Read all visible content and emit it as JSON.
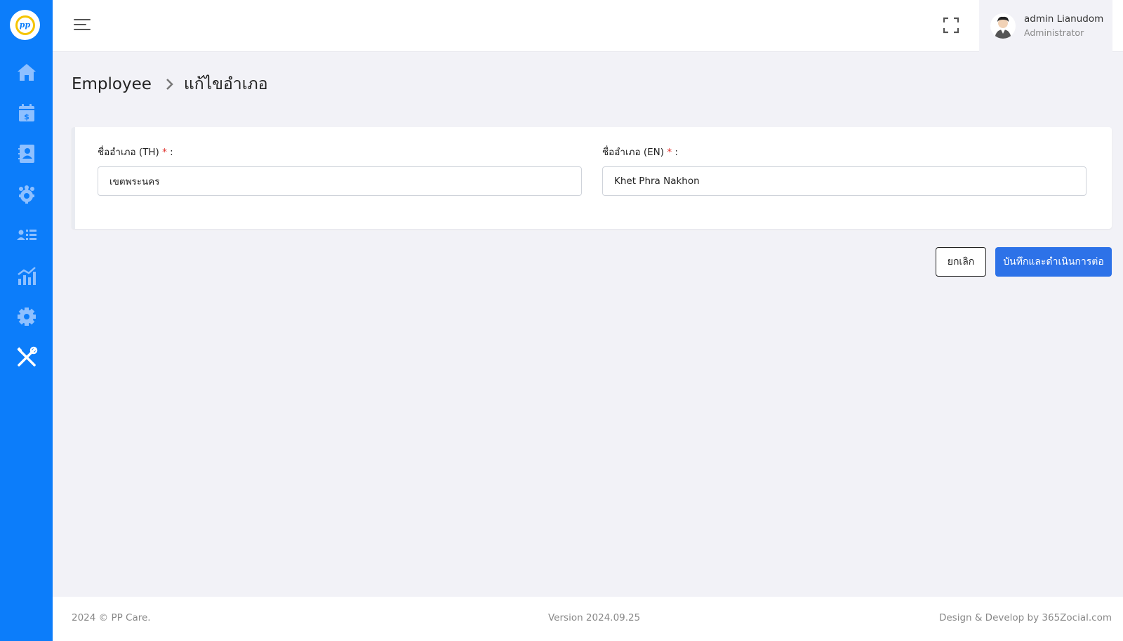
{
  "sidebar": {
    "logo_text": "pp",
    "items": [
      {
        "icon": "home-icon"
      },
      {
        "icon": "calendar-dollar-icon"
      },
      {
        "icon": "contact-book-icon"
      },
      {
        "icon": "people-gear-icon"
      },
      {
        "icon": "user-list-icon"
      },
      {
        "icon": "chart-icon"
      },
      {
        "icon": "gear-icon"
      },
      {
        "icon": "tools-icon"
      }
    ],
    "color": "#0c7dfa"
  },
  "header": {
    "user_name": "admin Lianudom",
    "user_role": "Administrator"
  },
  "breadcrumb": {
    "parent": "Employee",
    "current": "แก้ไขอำเภอ"
  },
  "form": {
    "th_label": "ชื่ออำเภอ (TH)",
    "th_value": "เขตพระนคร",
    "en_label": "ชื่ออำเภอ (EN)",
    "en_value": "Khet Phra Nakhon",
    "required_mark": "*",
    "label_suffix": ":"
  },
  "buttons": {
    "cancel": "ยกเลิก",
    "save": "บันทึกและดำเนินการต่อ",
    "save_color": "#2d72e8"
  },
  "footer": {
    "copyright": "2024 © PP Care.",
    "version": "Version 2024.09.25",
    "credit": "Design & Develop by 365Zocial.com"
  }
}
